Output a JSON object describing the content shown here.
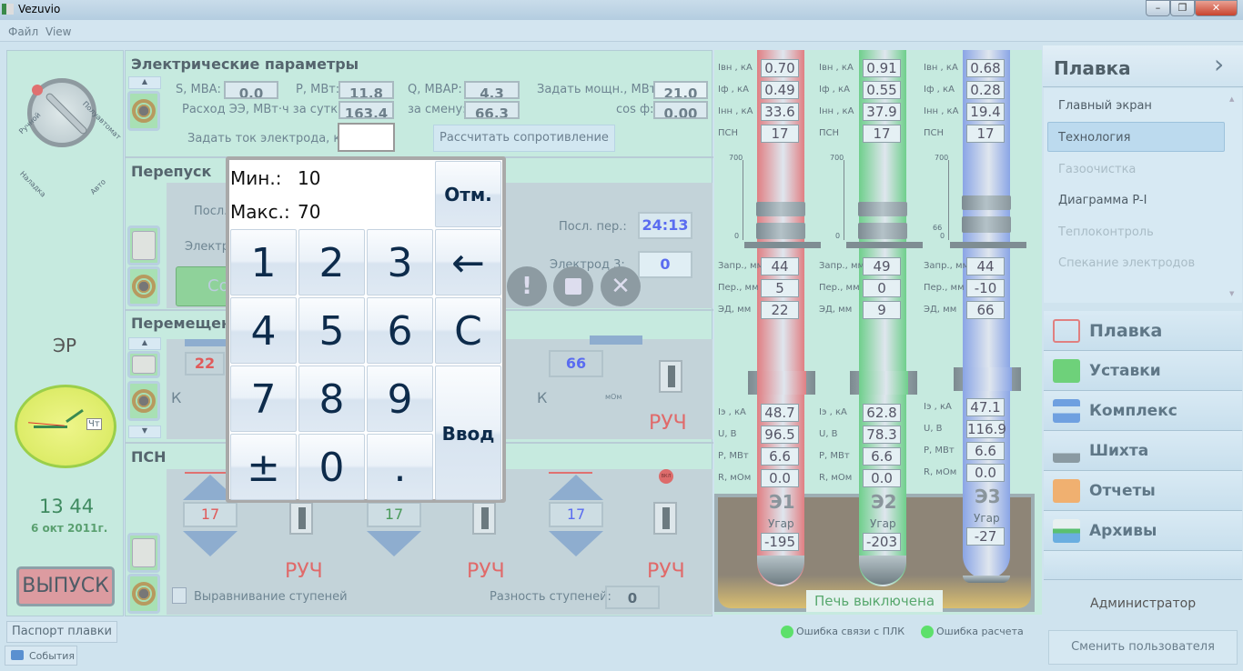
{
  "window": {
    "title": "Vezuvio",
    "menu": [
      "Файл",
      "View"
    ]
  },
  "left": {
    "mode_labels": [
      "Ручной",
      "Полуавтомат",
      "Наладка",
      "Авто"
    ],
    "er_label": "ЭР",
    "clock": {
      "day": "Чт",
      "time": "13 44",
      "date": "6 окт 2011г."
    },
    "release_button": "ВЫПУСК",
    "passport_button": "Паспорт плавки",
    "events_button": "События"
  },
  "electrical": {
    "title": "Электрические параметры",
    "s_label": "S, МВА:",
    "s_value": "0.0",
    "p_label": "P, МВт:",
    "p_value": "11.8",
    "q_label": "Q, МВАР:",
    "q_value": "4.3",
    "set_power_label": "Задать мощн., МВт:",
    "set_power_value": "21.0",
    "consumption_day_label": "Расход ЭЭ, МВт·ч за сутки:",
    "consumption_day_value": "163.4",
    "shift_label": "за смену:",
    "shift_value": "66.3",
    "cos_label": "cos ф:",
    "cos_value": "0.00",
    "set_current_label": "Задать ток электрода, кА:",
    "set_current_value": "",
    "calc_button": "Рассчитать сопротивление"
  },
  "bypass": {
    "title": "Перепуск",
    "last_label_partial": "Посл.",
    "electrode_label_partial": "Электр",
    "last_bypass_label": "Посл. пер.:",
    "last_bypass_value": "24:13",
    "electrode3_label": "Электрод 3:",
    "electrode3_value": "0",
    "lamp_button_partial": "Со"
  },
  "movement": {
    "title": "Перемещен",
    "e1_value": "22",
    "e1_k_label": "К",
    "e3_value": "66",
    "e3_k_label": "К",
    "e3_unit": "мОм",
    "e3_mode": "РУЧ"
  },
  "psn": {
    "title": "ПСН",
    "values": [
      "17",
      "17",
      "17"
    ],
    "modes": [
      "РУЧ",
      "РУЧ",
      "РУЧ"
    ],
    "switch_label": "ВКЛ",
    "equalize_label": "Выравнивание ступеней",
    "diff_label": "Разность ступеней:",
    "diff_value": "0"
  },
  "keypad": {
    "min_label": "Мин.:",
    "min_value": "10",
    "max_label": "Макс.:",
    "max_value": "70",
    "cancel": "Отм.",
    "backspace": "←",
    "clear": "C",
    "enter": "Ввод",
    "digits": [
      "1",
      "2",
      "3",
      "4",
      "5",
      "6",
      "7",
      "8",
      "9",
      "±",
      "0",
      "."
    ]
  },
  "electrodes": {
    "labels": {
      "ivn": "Iвн , кА",
      "if": "Iф , кА",
      "inn": "Iнн , кА",
      "psn": "ПСН",
      "zapr": "Запр., мм",
      "per": "Пер., мм",
      "ed": "ЭД, мм",
      "ie": "Iэ , кА",
      "u": "U, В",
      "p": "P, МВт",
      "r": "R, мОм",
      "ugar": "Угар"
    },
    "scale_max": "700",
    "scale_min": "0",
    "items": [
      {
        "name": "Э1",
        "color": "#e07f83",
        "ivn": "0.70",
        "if": "0.49",
        "inn": "33.6",
        "psn": "17",
        "zapr": "44",
        "per": "5",
        "ed": "22",
        "ie": "48.7",
        "u": "96.5",
        "p": "6.6",
        "r": "0.0",
        "ugar": "-195"
      },
      {
        "name": "Э2",
        "color": "#6fcf8c",
        "ivn": "0.91",
        "if": "0.55",
        "inn": "37.9",
        "psn": "17",
        "zapr": "49",
        "per": "0",
        "ed": "9",
        "ie": "62.8",
        "u": "78.3",
        "p": "6.6",
        "r": "0.0",
        "ugar": "-203"
      },
      {
        "name": "Э3",
        "color": "#8aa5e6",
        "ivn": "0.68",
        "if": "0.28",
        "inn": "19.4",
        "psn": "17",
        "zapr": "44",
        "per": "-10",
        "ed": "66",
        "ie": "47.1",
        "u": "116.9",
        "p": "6.6",
        "r": "0.0",
        "ugar": "-27",
        "scale_mark": "66"
      }
    ],
    "furnace_status": "Печь выключена"
  },
  "status": {
    "plc_error": "Ошибка связи с ПЛК",
    "calc_error": "Ошибка расчета",
    "indicator_color": "#5de06b"
  },
  "nav": {
    "section_title": "Плавка",
    "sub_items": [
      {
        "label": "Главный экран",
        "state": "normal"
      },
      {
        "label": "Технология",
        "state": "selected"
      },
      {
        "label": "Газоочистка",
        "state": "disabled"
      },
      {
        "label": "Диаграмма P-I",
        "state": "normal"
      },
      {
        "label": "Теплоконтроль",
        "state": "disabled"
      },
      {
        "label": "Спекание электродов",
        "state": "disabled"
      }
    ],
    "main_items": [
      "Плавка",
      "Уставки",
      "Комплекс",
      "Шихта",
      "Отчеты",
      "Архивы"
    ],
    "user": "Администратор",
    "switch_user": "Сменить пользователя"
  }
}
